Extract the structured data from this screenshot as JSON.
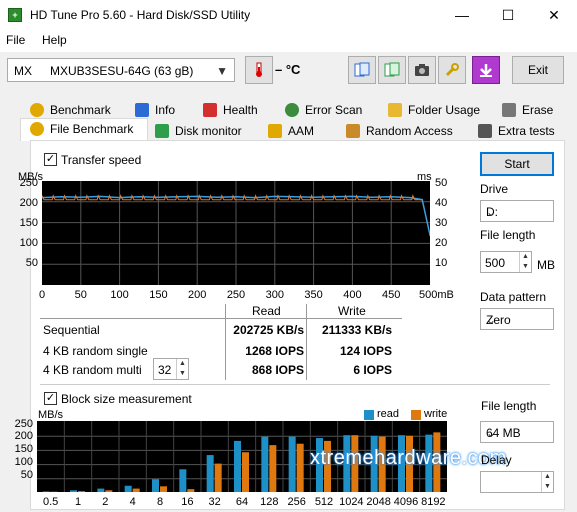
{
  "window": {
    "title": "HD Tune Pro 5.60 - Hard Disk/SSD Utility",
    "minimize": "—",
    "maximize": "☐",
    "close": "✕"
  },
  "menu": {
    "file": "File",
    "help": "Help"
  },
  "toolbar": {
    "drive_prefix": "MX",
    "drive_name": "MXUB3SESU-64G (63 gB)",
    "temperature": "– °C",
    "exit_label": "Exit"
  },
  "tabs_row1": [
    "Benchmark",
    "Info",
    "Health",
    "Error Scan",
    "Folder Usage",
    "Erase"
  ],
  "tabs_row2": [
    "File Benchmark",
    "Disk monitor",
    "AAM",
    "Random Access",
    "Extra tests"
  ],
  "tab_icon_colors": {
    "benchmark": "#e0a800",
    "info": "#2b6cd4",
    "health": "#d32f2f",
    "error_scan": "#3d8b3d",
    "folder_usage": "#e8b830",
    "erase": "#777777",
    "file_benchmark": "#e0a800",
    "disk_monitor": "#2e9e4a",
    "aam": "#e0a800",
    "random_access": "#c98a2a",
    "extra_tests": "#555555"
  },
  "transfer": {
    "checkbox_label": "Transfer speed",
    "checked": "✓",
    "left_unit": "MB/s",
    "right_unit": "ms",
    "y_left_ticks": [
      "250",
      "200",
      "150",
      "100",
      "50"
    ],
    "y_right_ticks": [
      "50",
      "40",
      "30",
      "20",
      "10"
    ],
    "x_ticks": [
      "0",
      "50",
      "100",
      "150",
      "200",
      "250",
      "300",
      "350",
      "400",
      "450",
      "500mB"
    ],
    "col_read": "Read",
    "col_write": "Write",
    "rows": [
      {
        "label": "Sequential",
        "read": "202725 KB/s",
        "write": "211333 KB/s"
      },
      {
        "label": "4 KB random single",
        "read": "1268 IOPS",
        "write": "124 IOPS"
      },
      {
        "label": "4 KB random multi",
        "read": "868 IOPS",
        "write": "6 IOPS"
      }
    ],
    "queue_depth": "32"
  },
  "block": {
    "checkbox_label": "Block size measurement",
    "unit": "MB/s",
    "legend_read": "read",
    "legend_write": "write",
    "y_ticks": [
      "250",
      "200",
      "150",
      "100",
      "50"
    ],
    "x_ticks": [
      "0.5",
      "1",
      "2",
      "4",
      "8",
      "16",
      "32",
      "64",
      "128",
      "256",
      "512",
      "1024",
      "2048",
      "4096",
      "8192"
    ]
  },
  "side": {
    "start_label": "Start",
    "drive_label": "Drive",
    "drive_value": "D:",
    "file_length_label": "File length",
    "file_length_value": "500",
    "file_length_unit": "MB",
    "pattern_label": "Data pattern",
    "pattern_value": "Zero",
    "file_length2_label": "File length",
    "file_length2_value": "64 MB",
    "delay_label": "Delay"
  },
  "watermark": "xtremehardware.com",
  "colors": {
    "read": "#1e90c8",
    "write": "#e07810",
    "speed_line": "#3aa0e0",
    "access_line": "#e07830"
  },
  "chart_data": [
    {
      "type": "line",
      "x_unit": "mB",
      "x": [
        0,
        25,
        50,
        75,
        100,
        125,
        150,
        175,
        200,
        225,
        250,
        275,
        300,
        325,
        350,
        375,
        400,
        425,
        450,
        475,
        490,
        500
      ],
      "series": [
        {
          "values": [
            210,
            212,
            211,
            213,
            210,
            212,
            211,
            212,
            213,
            211,
            212,
            210,
            213,
            212,
            211,
            212,
            213,
            211,
            212,
            210,
            205,
            120
          ]
        }
      ],
      "ylim": [
        0,
        250
      ],
      "xlim": [
        0,
        500
      ]
    },
    {
      "type": "bar",
      "categories": [
        "0.5",
        "1",
        "2",
        "4",
        "8",
        "16",
        "32",
        "64",
        "128",
        "256",
        "512",
        "1024",
        "2048",
        "4096",
        "8192"
      ],
      "series": [
        {
          "name": "read",
          "values": [
            2,
            6,
            12,
            22,
            45,
            80,
            130,
            180,
            195,
            195,
            190,
            200,
            198,
            200,
            202
          ]
        },
        {
          "name": "write",
          "values": [
            1,
            3,
            6,
            12,
            20,
            10,
            100,
            140,
            165,
            170,
            180,
            200,
            195,
            198,
            210
          ]
        }
      ],
      "ylim": [
        0,
        250
      ]
    }
  ]
}
